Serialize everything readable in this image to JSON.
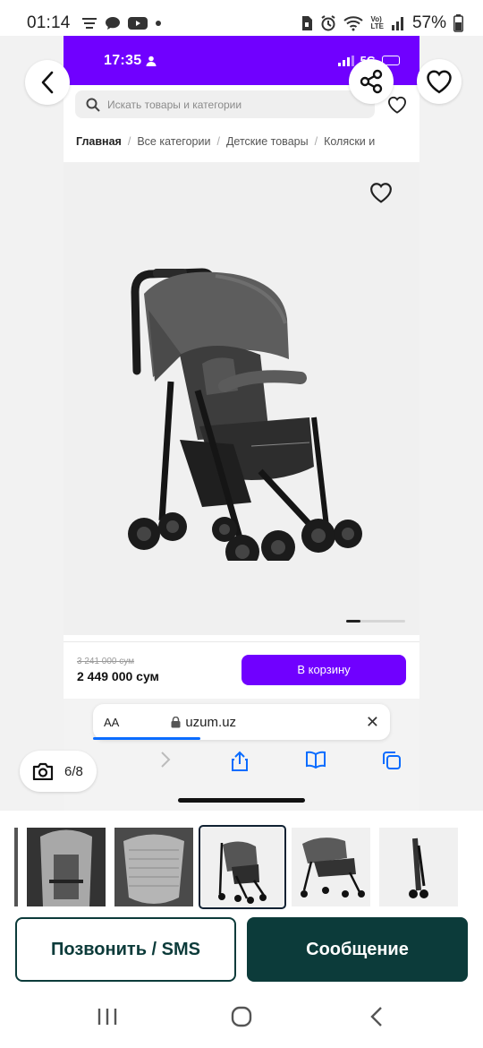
{
  "status_bar": {
    "time": "01:14",
    "network_top": "Vo)",
    "network_bottom": "LTE",
    "battery": "57%"
  },
  "inner_screenshot": {
    "status_time": "17:35",
    "network": "5G",
    "search_placeholder": "Искать товары и категории",
    "breadcrumb": [
      "Главная",
      "Все категории",
      "Детские товары",
      "Коляски и"
    ],
    "old_price": "3 241 000 сум",
    "new_price": "2 449 000 сум",
    "cart_button": "В корзину",
    "url_aa": "AA",
    "url": "uzum.uz",
    "brand_accent": "#7000ff"
  },
  "gallery": {
    "counter": "6/8",
    "current_index": 6,
    "total": 8
  },
  "actions": {
    "call_label": "Позвонить / SMS",
    "message_label": "Сообщение",
    "dark_color": "#0c3b3a"
  },
  "icons": {
    "back": "chevron-left-icon",
    "share": "share-icon",
    "favorite": "heart-icon",
    "camera": "camera-icon"
  }
}
